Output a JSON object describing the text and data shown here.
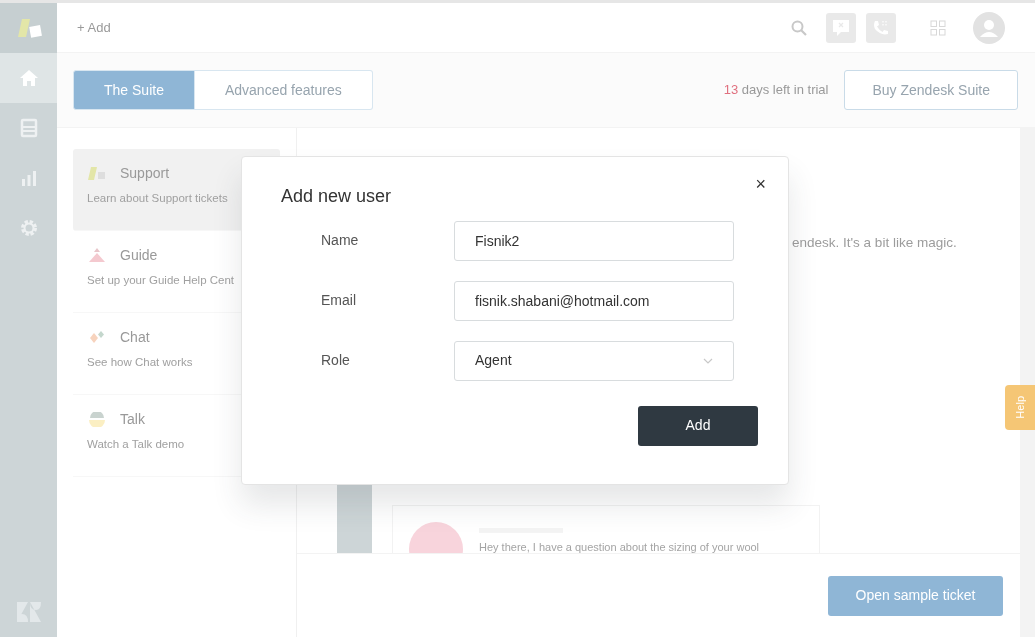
{
  "sidebar": {
    "items": [
      {
        "kind": "home",
        "selected": true
      },
      {
        "kind": "tickets",
        "selected": false
      },
      {
        "kind": "reports",
        "selected": false
      },
      {
        "kind": "settings",
        "selected": false
      }
    ]
  },
  "topbar": {
    "add_label": "+ Add"
  },
  "tabs": [
    {
      "label": "The Suite",
      "selected": true
    },
    {
      "label": "Advanced features",
      "selected": false
    }
  ],
  "trial": {
    "days": "13",
    "text": "days left in trial"
  },
  "buy_button": "Buy Zendesk Suite",
  "products": [
    {
      "kind": "support",
      "title": "Support",
      "subtitle": "Learn about Support tickets",
      "selected": true
    },
    {
      "kind": "guide",
      "title": "Guide",
      "subtitle": "Set up your Guide Help Cent",
      "selected": false
    },
    {
      "kind": "chat",
      "title": "Chat",
      "subtitle": "See how Chat works",
      "selected": false
    },
    {
      "kind": "talk",
      "title": "Talk",
      "subtitle": "Watch a Talk demo",
      "selected": false
    }
  ],
  "intro_text": "endesk. It's a bit like magic.",
  "sample_message": "Hey there, I have a question about the sizing of your wool",
  "help_tab": "Help",
  "open_ticket_button": "Open sample ticket",
  "dialog": {
    "title": "Add new user",
    "close": "×",
    "fields": [
      {
        "kind": "text",
        "label": "Name",
        "value": "Fisnik2"
      },
      {
        "kind": "text",
        "label": "Email",
        "value": "fisnik.shabani@hotmail.com"
      },
      {
        "kind": "select",
        "label": "Role",
        "value": "Agent"
      }
    ],
    "submit": "Add"
  }
}
